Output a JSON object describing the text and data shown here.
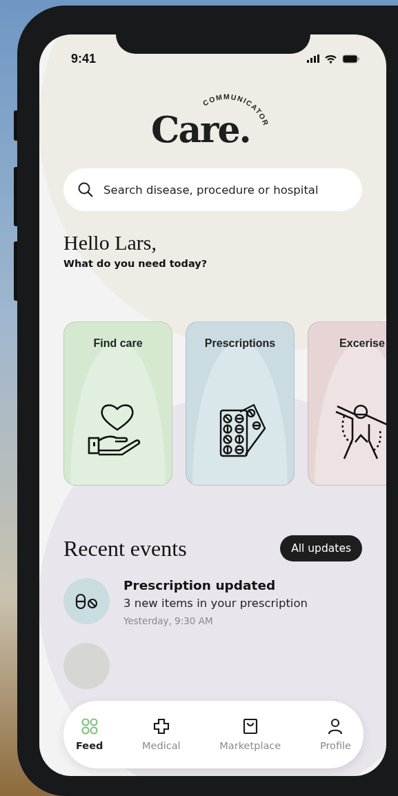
{
  "status_bar": {
    "time": "9:41"
  },
  "logo": {
    "tagline": "COMMUNICATOR",
    "wordmark": "Care."
  },
  "search": {
    "placeholder": "Search disease, procedure or hospital"
  },
  "greeting": {
    "title": "Hello Lars,",
    "subtitle": "What do you need today?"
  },
  "categories": [
    {
      "label": "Find care",
      "kind": "care",
      "color": "#d4e9d0"
    },
    {
      "label": "Prescriptions",
      "kind": "pills",
      "color": "#cadce1"
    },
    {
      "label": "Excerise",
      "kind": "exercise",
      "color": "#e7d5d6"
    }
  ],
  "recent_events": {
    "title": "Recent events",
    "button": "All updates",
    "items": [
      {
        "kind": "prescription",
        "color": "#c9dce0",
        "title": "Prescription updated",
        "subtitle": "3 new items in your prescription",
        "time": "Yesterday, 9:30 AM"
      },
      {
        "kind": "generic",
        "color": "#d6d6d2"
      }
    ]
  },
  "nav": [
    {
      "label": "Feed",
      "kind": "feed",
      "selected": true
    },
    {
      "label": "Medical",
      "kind": "medical",
      "selected": false
    },
    {
      "label": "Marketplace",
      "kind": "market",
      "selected": false
    },
    {
      "label": "Profile",
      "kind": "profile",
      "selected": false
    }
  ]
}
